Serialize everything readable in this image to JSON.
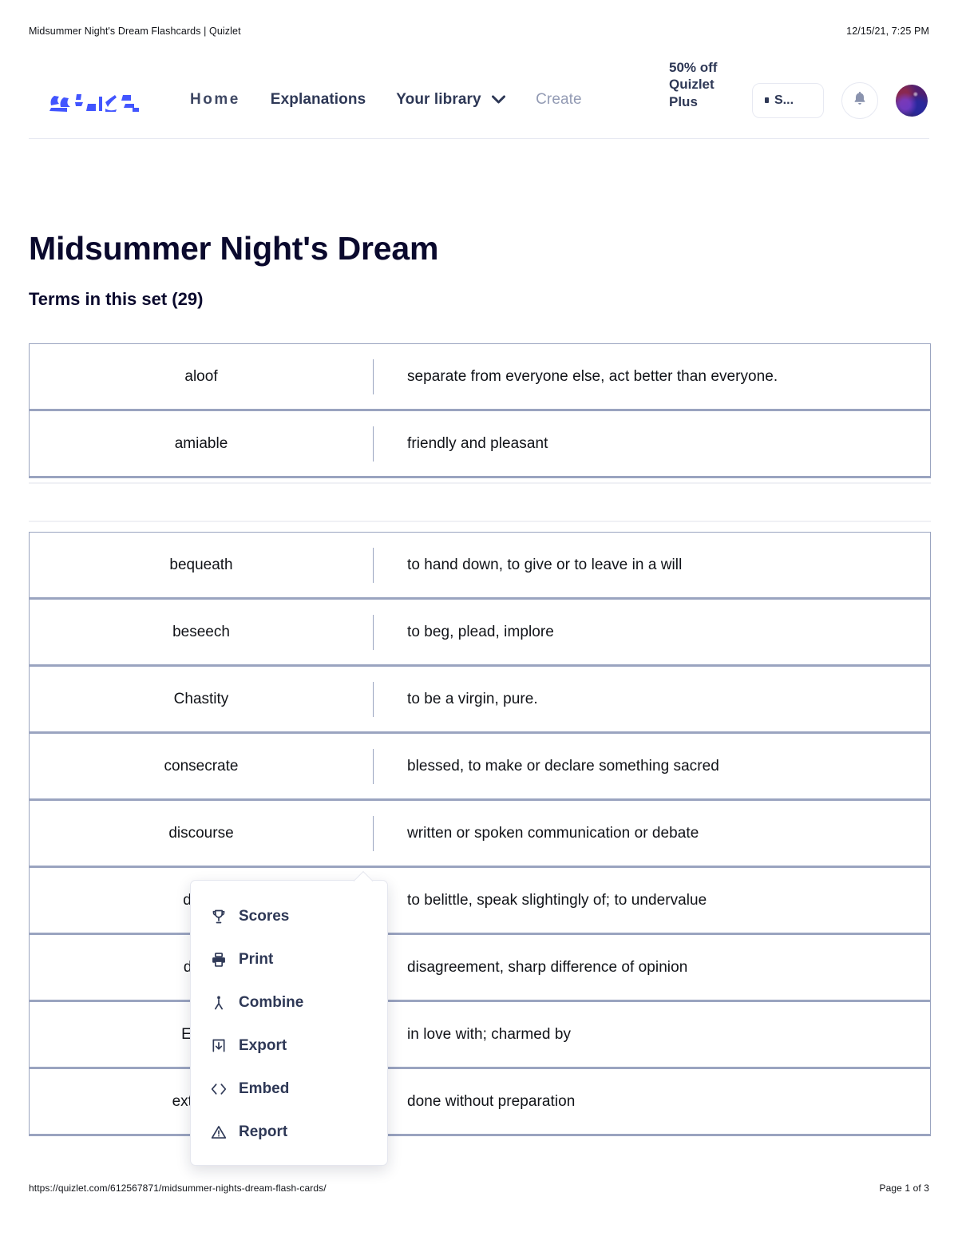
{
  "print_header": {
    "document_title": "Midsummer Night's Dream Flashcards | Quizlet",
    "timestamp": "12/15/21, 7:25 PM"
  },
  "print_footer": {
    "url": "https://quizlet.com/612567871/midsummer-nights-dream-flash-cards/",
    "page_label": "Page 1 of 3"
  },
  "nav": {
    "logo_text": "Quizlet",
    "links": [
      {
        "label": "Home"
      },
      {
        "label": "Explanations"
      },
      {
        "label": "Your library"
      },
      {
        "label": "Create"
      }
    ],
    "promo": "50% off Quizlet Plus",
    "search_label": "S...",
    "search_placeholder": "Search",
    "bell_label": "Notifications",
    "avatar_label": "Profile"
  },
  "page": {
    "title": "Midsummer Night's Dream",
    "subtitle": "Terms in this set (29)"
  },
  "term_groups": [
    {
      "rows": [
        {
          "term": "aloof",
          "definition": "separate from everyone else, act better than everyone."
        },
        {
          "term": "amiable",
          "definition": "friendly and pleasant"
        }
      ]
    },
    {
      "rows": [
        {
          "term": "bequeath",
          "definition": "to hand down, to give or to leave in a will"
        },
        {
          "term": "beseech",
          "definition": "to beg, plead, implore"
        },
        {
          "term": "Chastity",
          "definition": "to be a virgin, pure."
        },
        {
          "term": "consecrate",
          "definition": "blessed, to make or declare something sacred"
        },
        {
          "term": "discourse",
          "definition": "written or spoken communication or debate"
        },
        {
          "term": "dispa",
          "definition": "to belittle, speak slightingly of; to undervalue"
        },
        {
          "term": "disse",
          "definition": "disagreement, sharp difference of opinion"
        },
        {
          "term": "Enam",
          "definition": "in love with; charmed by"
        },
        {
          "term": "extempo",
          "definition": "done without preparation"
        }
      ]
    }
  ],
  "menu": {
    "items": [
      {
        "label": "Scores",
        "icon": "trophy-icon"
      },
      {
        "label": "Print",
        "icon": "printer-icon"
      },
      {
        "label": "Combine",
        "icon": "combine-icon"
      },
      {
        "label": "Export",
        "icon": "export-icon"
      },
      {
        "label": "Embed",
        "icon": "code-icon"
      },
      {
        "label": "Report",
        "icon": "warning-icon"
      }
    ]
  },
  "colors": {
    "brand": "#4255ff",
    "text": "#2e3856",
    "border": "#9aa4c0"
  }
}
